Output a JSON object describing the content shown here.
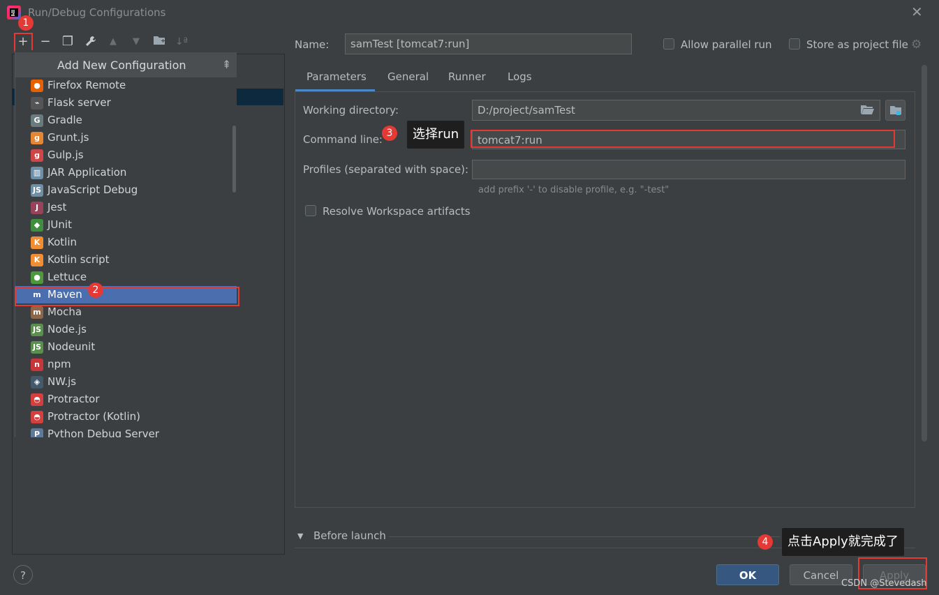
{
  "window": {
    "title": "Run/Debug Configurations",
    "close_glyph": "✕"
  },
  "toolbar": {
    "icons": [
      "plus-icon",
      "minus-icon",
      "copy-icon",
      "wrench-icon",
      "move-up-icon",
      "move-down-icon",
      "new-folder-icon",
      "sort-icon"
    ]
  },
  "popup": {
    "title": "Add New Configuration",
    "items": [
      {
        "label": "Firefox Remote",
        "icon": "firefox-icon",
        "color": "#e66000",
        "glyph": "●"
      },
      {
        "label": "Flask server",
        "icon": "flask-icon",
        "color": "#555555",
        "glyph": "⌁"
      },
      {
        "label": "Gradle",
        "icon": "gradle-icon",
        "color": "#6a7b7f",
        "glyph": "G"
      },
      {
        "label": "Grunt.js",
        "icon": "grunt-icon",
        "color": "#e48632",
        "glyph": "g"
      },
      {
        "label": "Gulp.js",
        "icon": "gulp-icon",
        "color": "#cf4646",
        "glyph": "g"
      },
      {
        "label": "JAR Application",
        "icon": "jar-icon",
        "color": "#6d8fa8",
        "glyph": "▥"
      },
      {
        "label": "JavaScript Debug",
        "icon": "js-debug-icon",
        "color": "#6f8fa6",
        "glyph": "JS"
      },
      {
        "label": "Jest",
        "icon": "jest-icon",
        "color": "#99425b",
        "glyph": "J"
      },
      {
        "label": "JUnit",
        "icon": "junit-icon",
        "color": "#3f8f3f",
        "glyph": "◆"
      },
      {
        "label": "Kotlin",
        "icon": "kotlin-icon",
        "color": "#f18e33",
        "glyph": "K"
      },
      {
        "label": "Kotlin script",
        "icon": "kotlin-script-icon",
        "color": "#f18e33",
        "glyph": "K"
      },
      {
        "label": "Lettuce",
        "icon": "lettuce-icon",
        "color": "#4c9a3c",
        "glyph": "●"
      },
      {
        "label": "Maven",
        "icon": "maven-icon",
        "color": "#4b6eaf",
        "glyph": "m"
      },
      {
        "label": "Mocha",
        "icon": "mocha-icon",
        "color": "#8d6748",
        "glyph": "m"
      },
      {
        "label": "Node.js",
        "icon": "nodejs-icon",
        "color": "#5b8f4e",
        "glyph": "JS"
      },
      {
        "label": "Nodeunit",
        "icon": "nodeunit-icon",
        "color": "#5b8f4e",
        "glyph": "JS"
      },
      {
        "label": "npm",
        "icon": "npm-icon",
        "color": "#c8363a",
        "glyph": "n"
      },
      {
        "label": "NW.js",
        "icon": "nwjs-icon",
        "color": "#44596b",
        "glyph": "◈"
      },
      {
        "label": "Protractor",
        "icon": "protractor-icon",
        "color": "#d43f3f",
        "glyph": "◓"
      },
      {
        "label": "Protractor (Kotlin)",
        "icon": "protractor-kotlin-icon",
        "color": "#d43f3f",
        "glyph": "◓"
      },
      {
        "label": "Python Debug Server",
        "icon": "python-debug-icon",
        "color": "#5d7a9a",
        "glyph": "P"
      }
    ]
  },
  "config": {
    "name_label": "Name:",
    "name_value": "samTest [tomcat7:run]",
    "allow_parallel_label": "Allow parallel run",
    "store_project_label": "Store as project file"
  },
  "tabs": [
    "Parameters",
    "General",
    "Runner",
    "Logs"
  ],
  "params": {
    "working_dir_label": "Working directory:",
    "working_dir_value": "D:/project/samTest",
    "command_line_label": "Command line:",
    "command_line_value": "tomcat7:run",
    "profiles_label": "Profiles (separated with space):",
    "profiles_value": "",
    "profiles_hint": "add prefix '-' to disable profile, e.g. \"-test\"",
    "resolve_label": "Resolve Workspace artifacts"
  },
  "before_launch": {
    "label": "Before launch"
  },
  "buttons": {
    "ok": "OK",
    "cancel": "Cancel",
    "apply": "Apply",
    "help": "?"
  },
  "annotations": {
    "badge1": "1",
    "badge2": "2",
    "badge3": "3",
    "badge4": "4",
    "tip3": "选择run",
    "tip4": "点击Apply就完成了"
  },
  "watermark": "CSDN @Stevedash",
  "colors": {
    "accent": "#4b6eaf",
    "annotation_red": "#e53935",
    "ok_button": "#365880"
  }
}
